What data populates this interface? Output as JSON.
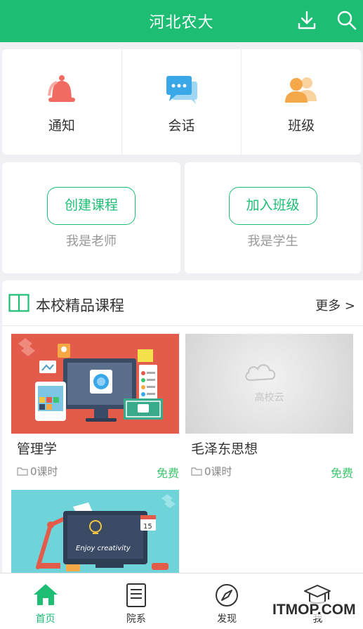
{
  "header": {
    "title": "河北农大"
  },
  "quick_actions": [
    {
      "label": "通知",
      "icon": "bell-icon"
    },
    {
      "label": "会话",
      "icon": "chat-icon"
    },
    {
      "label": "班级",
      "icon": "group-icon"
    }
  ],
  "roles": {
    "teacher": {
      "button": "创建课程",
      "sub": "我是老师"
    },
    "student": {
      "button": "加入班级",
      "sub": "我是学生"
    }
  },
  "courses_section": {
    "title": "本校精品课程",
    "more": "更多 >",
    "items": [
      {
        "name": "管理学",
        "hours": "0课时",
        "price": "免费"
      },
      {
        "name": "毛泽东思想",
        "hours": "0课时",
        "price": "免费",
        "placeholder": "高校云"
      },
      {
        "name": "",
        "hours": "",
        "price": ""
      }
    ]
  },
  "tabbar": [
    {
      "label": "首页",
      "active": true
    },
    {
      "label": "院系"
    },
    {
      "label": "发现"
    },
    {
      "label": "我"
    }
  ],
  "watermark": "ITMOP.COM",
  "colors": {
    "brand": "#1dbd74",
    "price": "#3fc46e"
  }
}
